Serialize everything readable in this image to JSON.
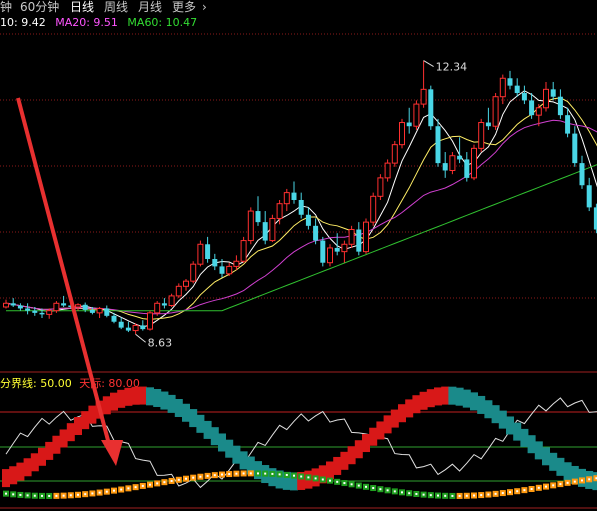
{
  "tabs": [
    {
      "label": "钟",
      "active": false
    },
    {
      "label": "60分钟",
      "active": false
    },
    {
      "label": "日线",
      "active": true
    },
    {
      "label": "周线",
      "active": false
    },
    {
      "label": "月线",
      "active": false
    },
    {
      "label": "更多",
      "active": false
    }
  ],
  "more_icon": "chevron-right-icon",
  "ma_legend": {
    "ma10": {
      "text": "10: 9.42",
      "color": "#ffffff"
    },
    "ma20": {
      "text": "MA20: 9.51",
      "color": "#ff55ff"
    },
    "ma60": {
      "text": "MA60: 10.47",
      "color": "#33dd33"
    }
  },
  "price_labels": {
    "high": "12.34",
    "low": "8.63"
  },
  "oscillator": {
    "label1": {
      "text": "分界线: 50.00",
      "color": "#ffff33"
    },
    "label2": {
      "text": "天际: 80.00",
      "color": "#ff3333"
    }
  },
  "colors": {
    "up": "#ff3030",
    "down": "#4ad6e6",
    "ma_white": "#ffffff",
    "ma_yellow": "#ffee66",
    "ma_magenta": "#d040d0",
    "ma_green": "#30c030",
    "grid": "#8b1a1a",
    "arrow": "#e83030",
    "osc_teal": "#1a8a8a",
    "osc_red": "#d81818",
    "osc_orange": "#ff9a10",
    "osc_green": "#20a020"
  },
  "chart_data": {
    "type": "candlestick",
    "high_marker": 12.34,
    "low_marker": 8.63,
    "ma_values": {
      "MA10": 9.42,
      "MA20": 9.51,
      "MA60": 10.47
    },
    "ohlc": [
      [
        9.0,
        9.1,
        8.98,
        9.05
      ],
      [
        9.05,
        9.12,
        9.0,
        9.02
      ],
      [
        9.02,
        9.05,
        8.95,
        8.98
      ],
      [
        8.98,
        9.05,
        8.9,
        8.95
      ],
      [
        8.95,
        9.0,
        8.88,
        8.92
      ],
      [
        8.92,
        8.98,
        8.85,
        8.9
      ],
      [
        8.9,
        8.98,
        8.84,
        8.95
      ],
      [
        8.95,
        9.08,
        8.92,
        9.05
      ],
      [
        9.05,
        9.15,
        9.0,
        9.02
      ],
      [
        9.02,
        9.1,
        8.98,
        9.0
      ],
      [
        9.0,
        9.05,
        8.95,
        9.03
      ],
      [
        9.03,
        9.06,
        8.93,
        8.96
      ],
      [
        8.96,
        9.0,
        8.9,
        8.92
      ],
      [
        8.92,
        9.0,
        8.85,
        8.98
      ],
      [
        8.98,
        9.02,
        8.86,
        8.88
      ],
      [
        8.88,
        8.92,
        8.78,
        8.8
      ],
      [
        8.8,
        8.86,
        8.7,
        8.72
      ],
      [
        8.72,
        8.8,
        8.66,
        8.68
      ],
      [
        8.68,
        8.78,
        8.63,
        8.75
      ],
      [
        8.75,
        8.82,
        8.68,
        8.7
      ],
      [
        8.7,
        8.95,
        8.68,
        8.92
      ],
      [
        8.92,
        9.08,
        8.88,
        9.05
      ],
      [
        9.05,
        9.12,
        8.98,
        9.02
      ],
      [
        9.02,
        9.18,
        9.0,
        9.15
      ],
      [
        9.15,
        9.32,
        9.12,
        9.28
      ],
      [
        9.28,
        9.38,
        9.22,
        9.35
      ],
      [
        9.35,
        9.62,
        9.32,
        9.58
      ],
      [
        9.58,
        9.9,
        9.55,
        9.85
      ],
      [
        9.85,
        9.95,
        9.6,
        9.65
      ],
      [
        9.65,
        9.72,
        9.5,
        9.55
      ],
      [
        9.55,
        9.65,
        9.4,
        9.45
      ],
      [
        9.45,
        9.6,
        9.42,
        9.55
      ],
      [
        9.55,
        9.7,
        9.5,
        9.62
      ],
      [
        9.62,
        9.95,
        9.6,
        9.9
      ],
      [
        9.9,
        10.35,
        9.85,
        10.3
      ],
      [
        10.3,
        10.5,
        10.1,
        10.15
      ],
      [
        10.15,
        10.3,
        9.85,
        9.9
      ],
      [
        9.9,
        10.25,
        9.88,
        10.2
      ],
      [
        10.2,
        10.45,
        10.12,
        10.4
      ],
      [
        10.4,
        10.6,
        10.3,
        10.55
      ],
      [
        10.55,
        10.7,
        10.4,
        10.45
      ],
      [
        10.45,
        10.55,
        10.2,
        10.25
      ],
      [
        10.25,
        10.35,
        10.05,
        10.1
      ],
      [
        10.1,
        10.2,
        9.85,
        9.9
      ],
      [
        9.9,
        9.95,
        9.55,
        9.6
      ],
      [
        9.6,
        9.85,
        9.55,
        9.8
      ],
      [
        9.8,
        10.0,
        9.7,
        9.75
      ],
      [
        9.75,
        9.9,
        9.6,
        9.85
      ],
      [
        9.85,
        10.1,
        9.8,
        10.05
      ],
      [
        10.05,
        10.15,
        9.7,
        9.75
      ],
      [
        9.75,
        10.2,
        9.72,
        10.15
      ],
      [
        10.15,
        10.55,
        10.1,
        10.5
      ],
      [
        10.5,
        10.8,
        10.45,
        10.75
      ],
      [
        10.75,
        11.0,
        10.7,
        10.95
      ],
      [
        10.95,
        11.25,
        10.9,
        11.2
      ],
      [
        11.2,
        11.55,
        11.15,
        11.5
      ],
      [
        11.5,
        11.7,
        11.35,
        11.45
      ],
      [
        11.45,
        11.8,
        11.4,
        11.75
      ],
      [
        11.75,
        12.34,
        11.7,
        11.95
      ],
      [
        11.95,
        12.0,
        11.4,
        11.45
      ],
      [
        11.45,
        11.55,
        10.9,
        10.95
      ],
      [
        10.95,
        11.1,
        10.75,
        10.85
      ],
      [
        10.85,
        11.1,
        10.8,
        11.05
      ],
      [
        11.05,
        11.3,
        10.95,
        11.0
      ],
      [
        11.0,
        11.1,
        10.7,
        10.75
      ],
      [
        10.75,
        11.2,
        10.72,
        11.15
      ],
      [
        11.15,
        11.55,
        11.1,
        11.5
      ],
      [
        11.5,
        11.7,
        11.4,
        11.45
      ],
      [
        11.45,
        11.9,
        11.4,
        11.85
      ],
      [
        11.85,
        12.15,
        11.75,
        12.1
      ],
      [
        12.1,
        12.2,
        11.95,
        12.0
      ],
      [
        12.0,
        12.1,
        11.85,
        11.9
      ],
      [
        11.9,
        12.0,
        11.75,
        11.8
      ],
      [
        11.8,
        11.9,
        11.55,
        11.6
      ],
      [
        11.6,
        11.75,
        11.45,
        11.7
      ],
      [
        11.7,
        12.05,
        11.65,
        11.95
      ],
      [
        11.95,
        12.05,
        11.8,
        11.85
      ],
      [
        11.85,
        11.95,
        11.55,
        11.6
      ],
      [
        11.6,
        11.7,
        11.3,
        11.35
      ],
      [
        11.35,
        11.45,
        10.9,
        10.95
      ],
      [
        10.95,
        11.05,
        10.6,
        10.65
      ],
      [
        10.65,
        10.75,
        10.3,
        10.35
      ],
      [
        10.35,
        10.4,
        10.0,
        10.05
      ],
      [
        10.05,
        10.1,
        9.75,
        9.8
      ]
    ],
    "osc_levels": {
      "boundary": 50,
      "sky": 80
    }
  }
}
